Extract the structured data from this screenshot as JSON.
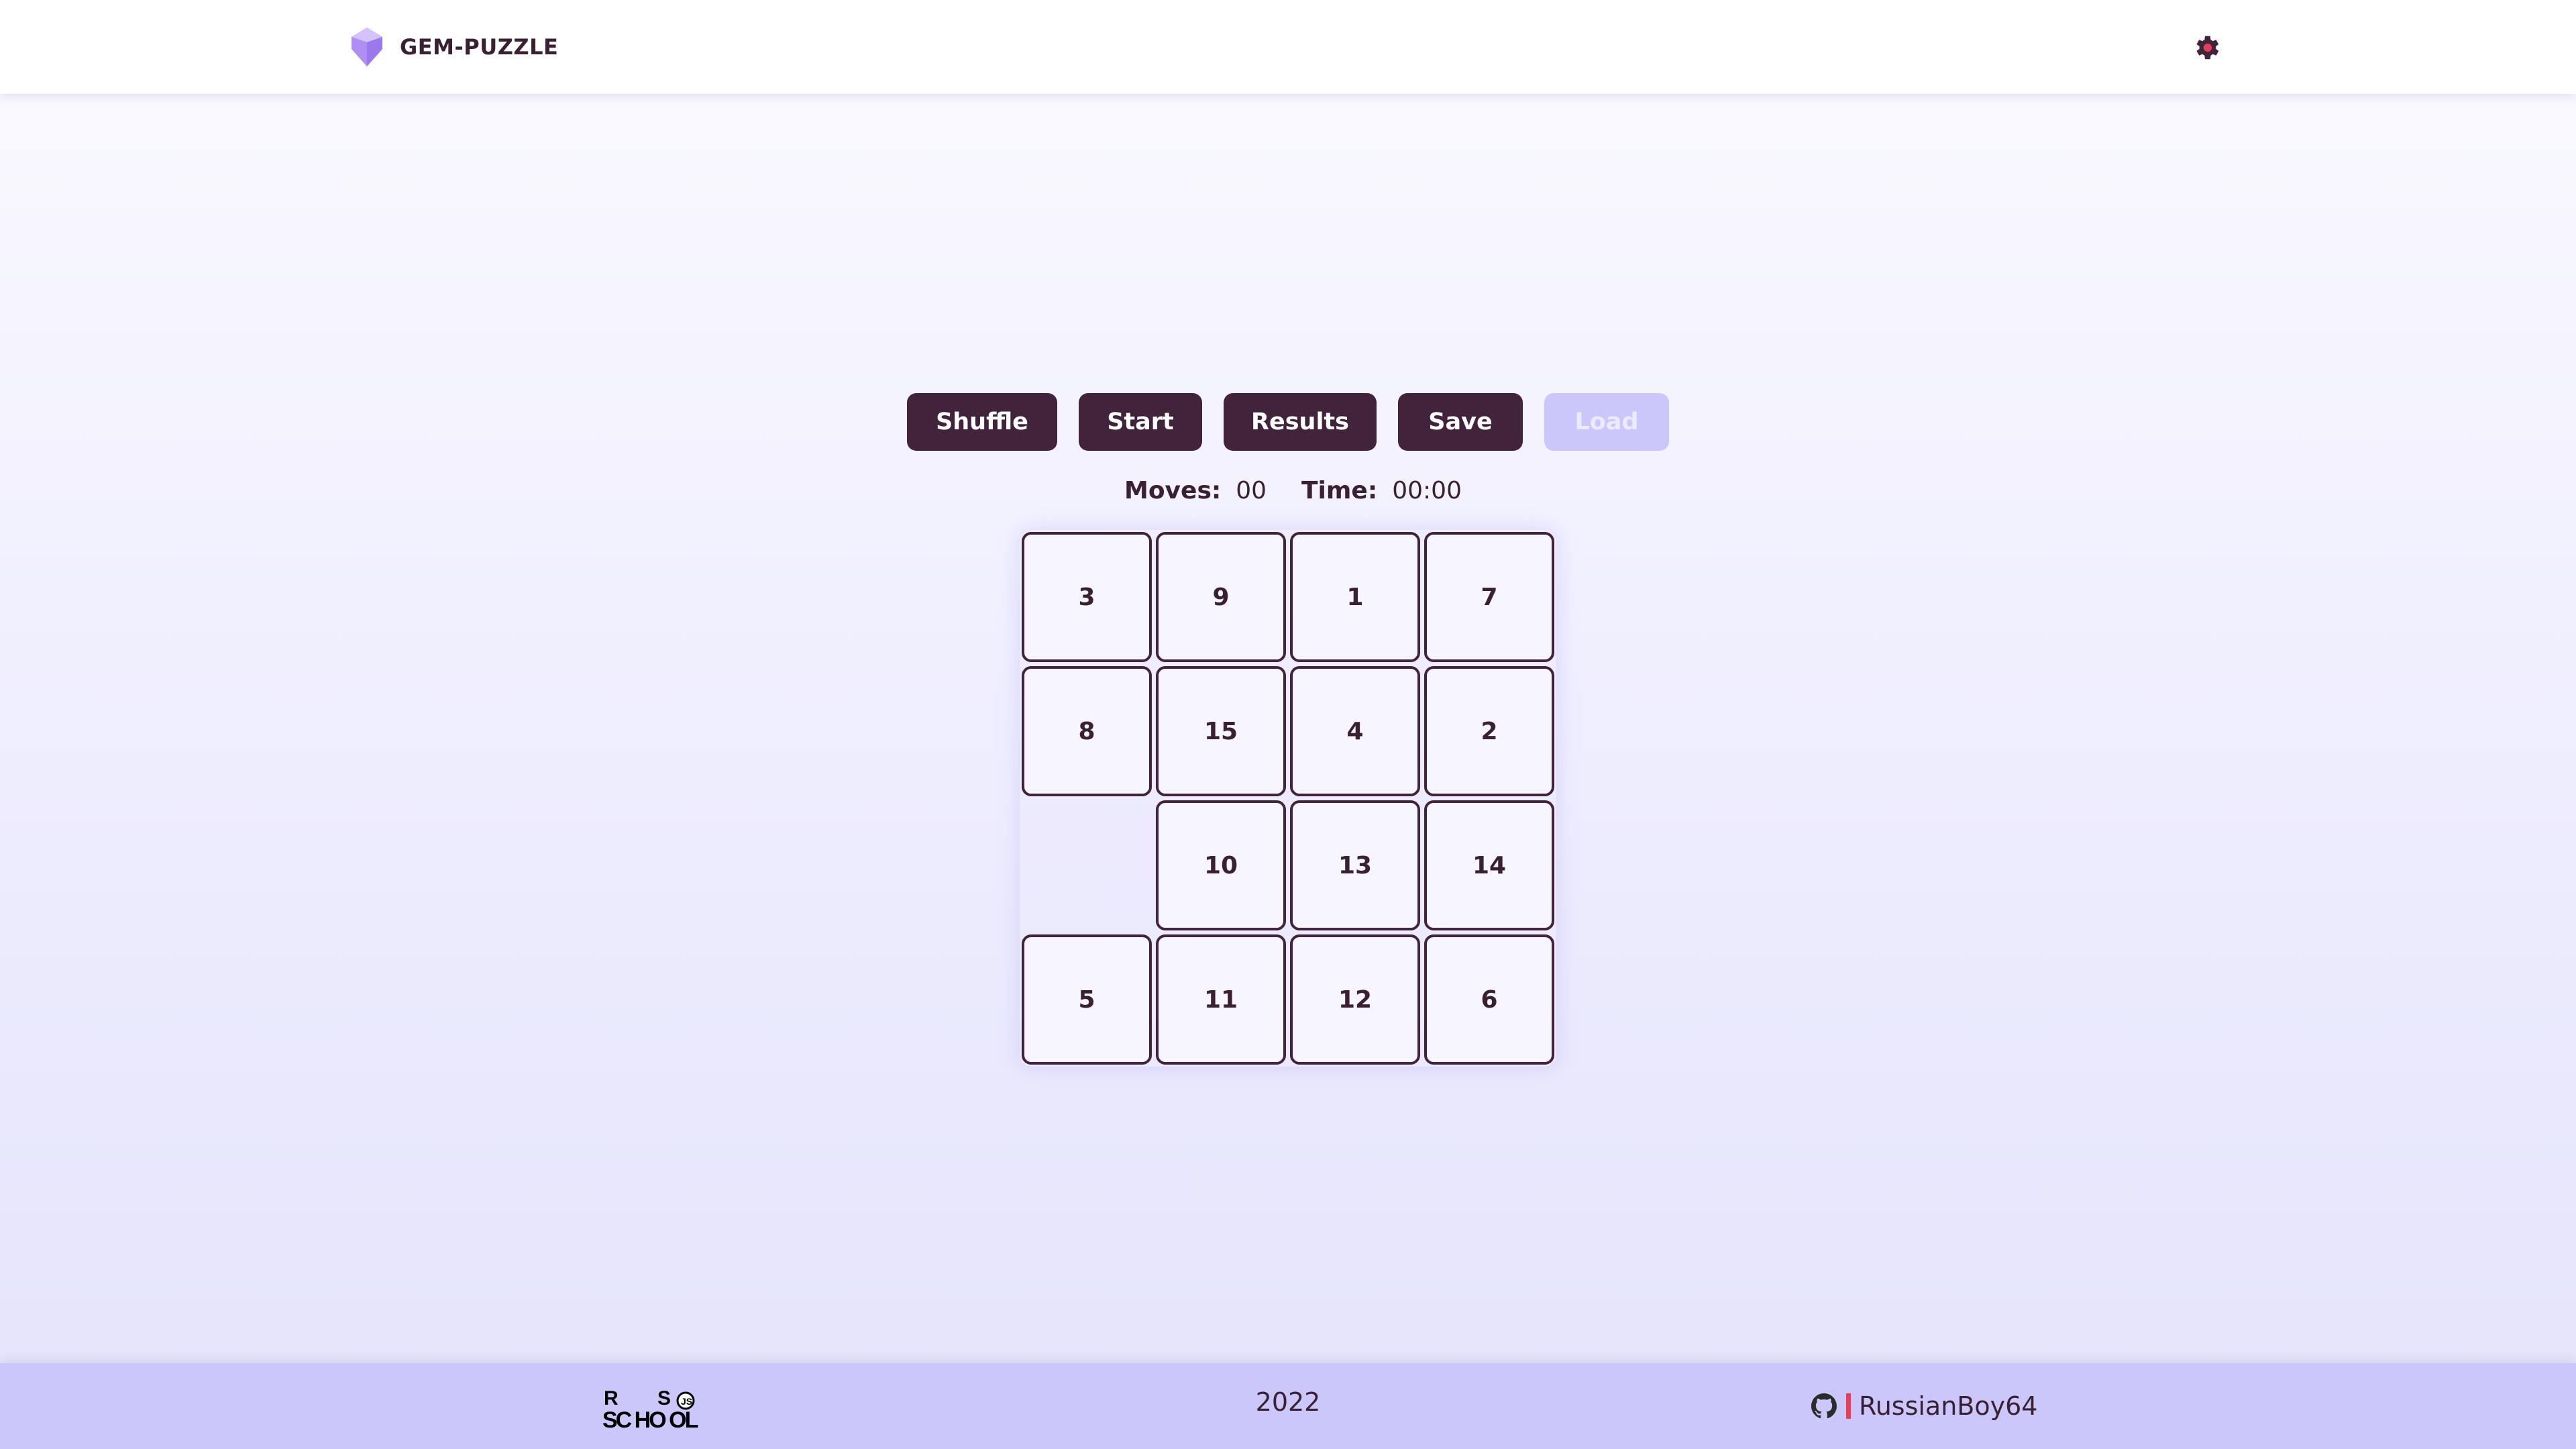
{
  "app": {
    "name": "GEM-PUZZLE",
    "accent_color": "#42233c",
    "disabled_color": "#cbc7fb",
    "footer_color": "#cbc7fb"
  },
  "header": {
    "logo_text": "GEM-PUZZLE",
    "logo_icon": "gem-icon",
    "settings_icon": "gear-icon"
  },
  "controls": {
    "shuffle_label": "Shuffle",
    "start_label": "Start",
    "results_label": "Results",
    "save_label": "Save",
    "load_label": "Load",
    "load_disabled": true
  },
  "stats": {
    "moves_label": "Moves:",
    "moves_value": "00",
    "time_label": "Time:",
    "time_value": "00:00"
  },
  "board": {
    "size": 4,
    "tiles": [
      [
        3,
        9,
        1,
        7
      ],
      [
        8,
        15,
        4,
        2
      ],
      [
        null,
        10,
        13,
        14
      ],
      [
        5,
        11,
        12,
        6
      ]
    ]
  },
  "footer": {
    "school_logo": "rs-school-logo",
    "year": "2022",
    "github_icon": "github-icon",
    "github_user": "RussianBoy64"
  }
}
